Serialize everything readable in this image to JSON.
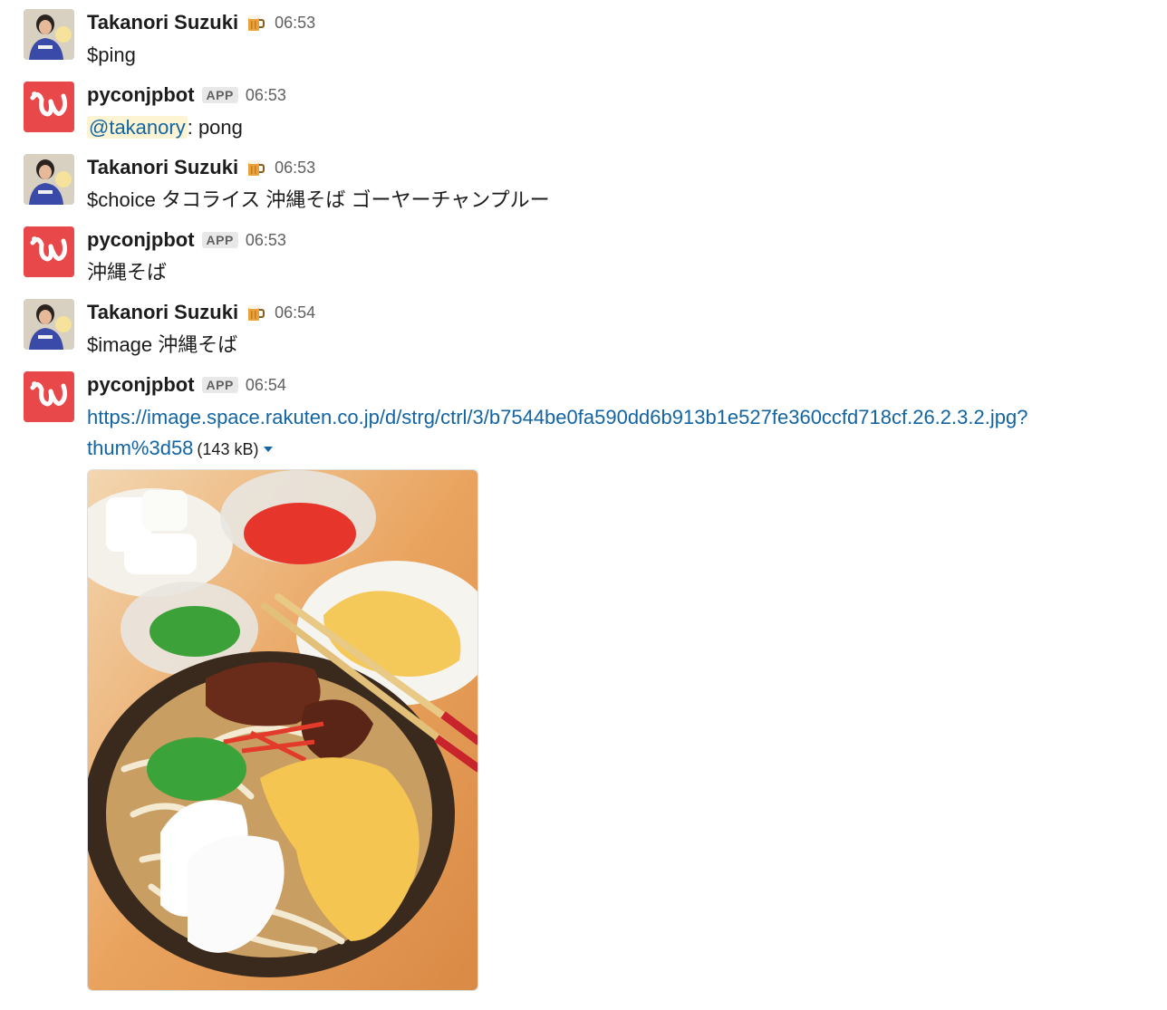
{
  "messages": [
    {
      "author": "Takanori Suzuki",
      "status_emoji": "beer-mug-icon",
      "time": "06:53",
      "text": "$ping"
    },
    {
      "author": "pyconjpbot",
      "badge": "APP",
      "time": "06:53",
      "mention": "@takanory",
      "text": ": pong"
    },
    {
      "author": "Takanori Suzuki",
      "status_emoji": "beer-mug-icon",
      "time": "06:53",
      "text": "$choice タコライス 沖縄そば ゴーヤーチャンプルー"
    },
    {
      "author": "pyconjpbot",
      "badge": "APP",
      "time": "06:53",
      "text": "沖縄そば"
    },
    {
      "author": "Takanori Suzuki",
      "status_emoji": "beer-mug-icon",
      "time": "06:54",
      "text": "$image 沖縄そば"
    },
    {
      "author": "pyconjpbot",
      "badge": "APP",
      "time": "06:54",
      "link_line1": "https://image.space.rakuten.co.jp/d/strg/ctrl/3/b7544be0fa590dd6b913b1e527fe360ccfd718cf.26.2.3.2.jpg?",
      "link_line2": "thum%3d58",
      "file_size": "(143 kB)"
    }
  ],
  "colors": {
    "link": "#1264a3",
    "mention_bg": "#fdf4d3",
    "bot_avatar": "#e8484a",
    "timestamp": "#616061"
  }
}
